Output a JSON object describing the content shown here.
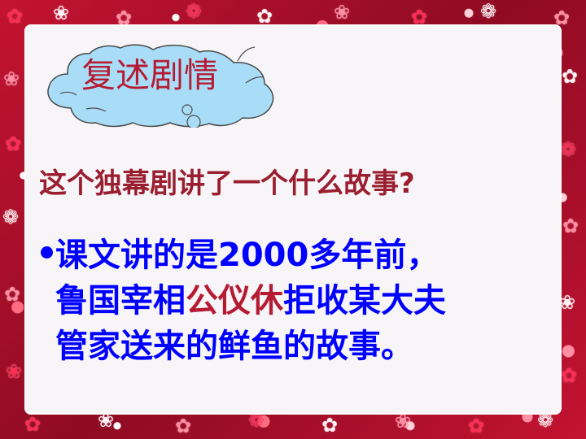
{
  "slide": {
    "title": "复述剧情",
    "question": "这个独幕剧讲了一个什么故事?",
    "answer": {
      "line1": "课文讲的是2000多年前，",
      "line2_prefix": "鲁国宰相",
      "line2_highlight": "公仪休",
      "line2_suffix": "拒收某大夫",
      "line3": "管家送来的鲜鱼的故事。"
    }
  },
  "icons": {
    "title_shape": "cloud-icon",
    "bullet": "bullet-dot-icon"
  },
  "colors": {
    "border": "#b0102a",
    "panel": "#f7f5f7",
    "title_text": "#b51c33",
    "question_text": "#9a1e2f",
    "answer_text": "#0000ff",
    "answer_highlight": "#b51c33",
    "cloud_fill": "#a9ddf7"
  }
}
